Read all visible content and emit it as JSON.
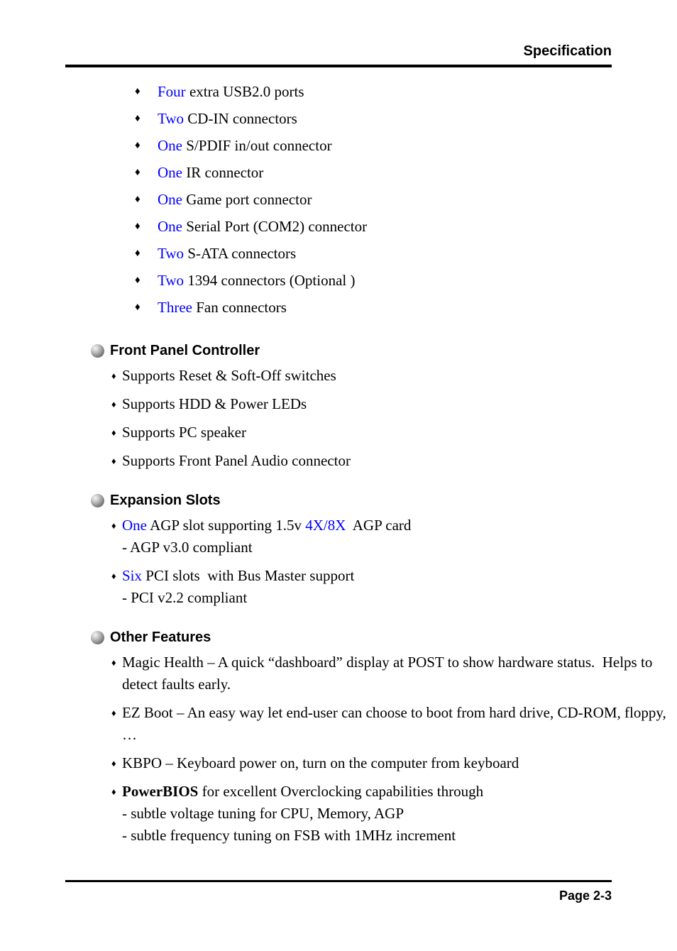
{
  "header": {
    "title": "Specification"
  },
  "footer": {
    "page_label": "Page 2-3"
  },
  "bullets": {
    "diamond": "♦",
    "small_diamond": "♦"
  },
  "connectors": [
    {
      "qty": "Four",
      "text": " extra USB2.0 ports"
    },
    {
      "qty": "Two",
      "text": " CD-IN connectors"
    },
    {
      "qty": "One",
      "text": " S/PDIF in/out connector"
    },
    {
      "qty": "One",
      "text": " IR connector"
    },
    {
      "qty": "One",
      "text": " Game port connector"
    },
    {
      "qty": "One",
      "text": " Serial Port (COM2) connector"
    },
    {
      "qty": "Two",
      "text": " S-ATA connectors"
    },
    {
      "qty": "Two",
      "text": " 1394 connectors (Optional )"
    },
    {
      "qty": "Three",
      "text": " Fan connectors"
    }
  ],
  "sections": {
    "front_panel": {
      "heading": "Front Panel Controller",
      "items": [
        "Supports Reset & Soft-Off switches",
        "Supports HDD & Power LEDs",
        "Supports PC speaker",
        "Supports Front Panel Audio connector"
      ]
    },
    "expansion_slots": {
      "heading": "Expansion Slots",
      "agp": {
        "qty": "One",
        "mid": " AGP slot supporting 1.5v ",
        "speed": "4X/8X",
        "tail": "  AGP card",
        "sub": "- AGP v3.0 compliant"
      },
      "pci": {
        "qty": "Six",
        "text": " PCI slots  with Bus Master support",
        "sub": "- PCI v2.2 compliant"
      }
    },
    "other_features": {
      "heading": "Other Features",
      "magic_health": "Magic Health – A quick “dashboard” display at POST to show hardware status.  Helps to detect faults early.",
      "ez_boot": "EZ Boot – An easy way let end-user can choose to boot from hard drive, CD-ROM, floppy, …",
      "kbpo": "KBPO – Keyboard power on, turn on the computer from keyboard",
      "powerbios_bold": "PowerBIOS",
      "powerbios_rest": " for excellent Overclocking capabilities through",
      "powerbios_sub1": "- subtle voltage tuning for CPU, Memory, AGP",
      "powerbios_sub2": "- subtle frequency tuning on FSB with 1MHz increment"
    }
  }
}
